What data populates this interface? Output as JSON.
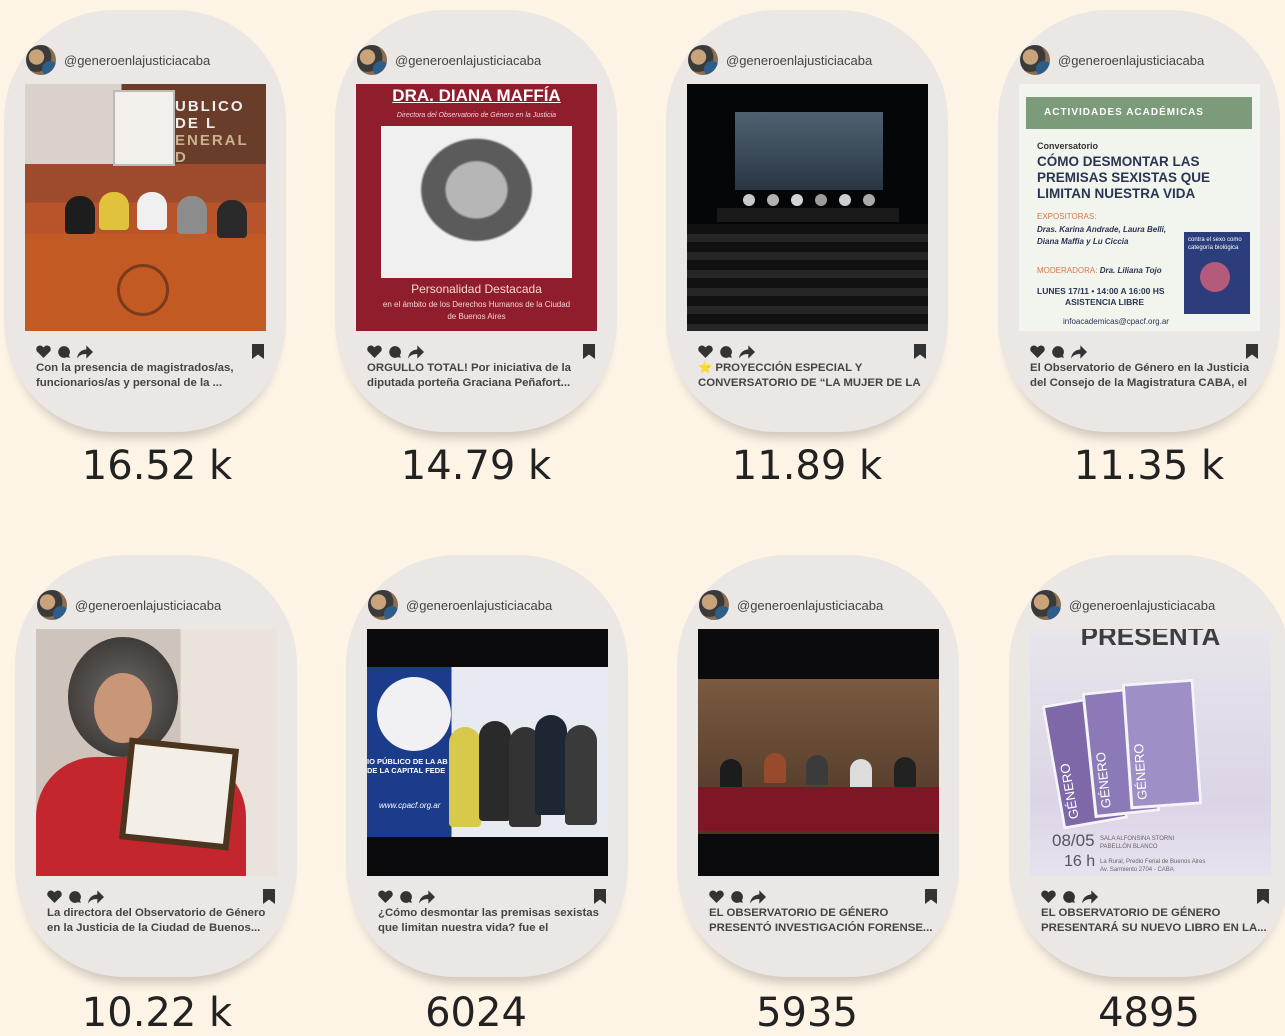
{
  "cards": [
    {
      "handle": "@generoenlajusticiacaba",
      "caption": "Con la presencia de magistrados/as, funcionarios/as y personal de la ...",
      "count": "16.52 k",
      "media": {
        "wall_sign": "UBLICO DE L",
        "wall_sign_2": "ENERAL D"
      }
    },
    {
      "handle": "@generoenlajusticiacaba",
      "caption": "ORGULLO TOTAL! Por iniciativa de la diputada porteña Graciana Peñafort...",
      "count": "14.79 k",
      "media": {
        "title": "DRA. DIANA MAFFÍA",
        "subtitle": "Directora del Observatorio de Género en la Justicia",
        "award": "Personalidad Destacada",
        "award_detail": "en el ámbito de los Derechos Humanos de la Ciudad de Buenos Aires"
      }
    },
    {
      "handle": "@generoenlajusticiacaba",
      "caption": "⭐ PROYECCIÓN ESPECIAL Y CONVERSATORIO DE “LA MUJER DE LA",
      "count": "11.89 k"
    },
    {
      "handle": "@generoenlajusticiacaba",
      "caption": "El Observatorio de Género en la Justicia del Consejo de la Magistratura CABA, el",
      "count": "11.35 k",
      "media": {
        "band": "ACTIVIDADES ACADÉMICAS",
        "kind": "Conversatorio",
        "headline": "CÓMO DESMONTAR LAS PREMISAS SEXISTAS QUE LIMITAN NUESTRA VIDA",
        "label_speakers": "EXPOSITORAS:",
        "speakers": "Dras. Karina Andrade, Laura Belli, Diana Maffia y Lu Ciccia",
        "label_moderator": "MODERADORA:",
        "moderator": "Dra. Liliana Tojo",
        "when": "LUNES 17/11 • 14:00 A 16:00 HS",
        "access": "ASISTENCIA LIBRE",
        "email": "infoacademicas@cpacf.org.ar",
        "book_text": "contra el sexo como categoría biológica"
      }
    },
    {
      "handle": "@generoenlajusticiacaba",
      "caption": "La directora del Observatorio de Género en la Justicia de la Ciudad de Buenos...",
      "count": "10.22 k"
    },
    {
      "handle": "@generoenlajusticiacaba",
      "caption": "¿Cómo desmontar las premisas sexistas que limitan nuestra vida? fue el disparad...",
      "count": "6024",
      "media": {
        "banner": "IO PÚBLICO DE LA AB DE LA CAPITAL FEDE",
        "web": "www.cpacf.org.ar"
      }
    },
    {
      "handle": "@generoenlajusticiacaba",
      "caption": "EL OBSERVATORIO DE GÉNERO PRESENTÓ INVESTIGACIÓN FORENSE...",
      "count": "5935"
    },
    {
      "handle": "@generoenlajusticiacaba",
      "caption": "EL OBSERVATORIO DE GÉNERO PRESENTARÁ SU NUEVO LIBRO EN LA...",
      "count": "4895",
      "media": {
        "heading": "PRESENTA",
        "book_word": "GÉNERO",
        "date": "08/05",
        "hour": "16 h",
        "venue_1": "SALA ALFONSINA STORNI",
        "venue_2": "PABELLÓN BLANCO",
        "venue_3": "La Rural, Predio Ferial de Buenos Aires",
        "venue_4": "Av. Sarmiento 2704 - CABA"
      }
    }
  ],
  "colors": {
    "background": "#fdf4e6",
    "card": "#ebe7e4",
    "icon": "#333333"
  }
}
